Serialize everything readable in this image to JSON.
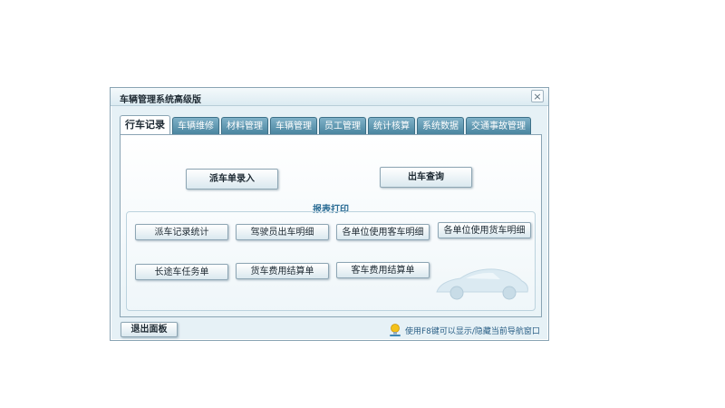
{
  "window": {
    "title": "车辆管理系统高级版",
    "close_glyph": "×"
  },
  "tabs": [
    {
      "label": "行车记录",
      "active": true
    },
    {
      "label": "车辆维修",
      "active": false
    },
    {
      "label": "材料管理",
      "active": false
    },
    {
      "label": "车辆管理",
      "active": false
    },
    {
      "label": "员工管理",
      "active": false
    },
    {
      "label": "统计核算",
      "active": false
    },
    {
      "label": "系统数据",
      "active": false
    },
    {
      "label": "交通事故管理",
      "active": false
    }
  ],
  "main_buttons": {
    "dispatch_entry": "派车单录入",
    "departure_query": "出车查询"
  },
  "report_section": {
    "title": "报表打印",
    "buttons": [
      "派车记录统计",
      "驾驶员出车明细",
      "各单位使用客车明细",
      "各单位使用货车明细",
      "长途车任务单",
      "货车费用结算单",
      "客车费用结算单"
    ]
  },
  "footer": {
    "exit_label": "退出面板",
    "hint": "使用F8键可以显示/隐藏当前导航窗口",
    "hint_icon": "lightbulb-icon"
  },
  "colors": {
    "tab_bg": "#4a859f",
    "section_title": "#2d6e96",
    "window_bg": "#e6f1f6"
  }
}
